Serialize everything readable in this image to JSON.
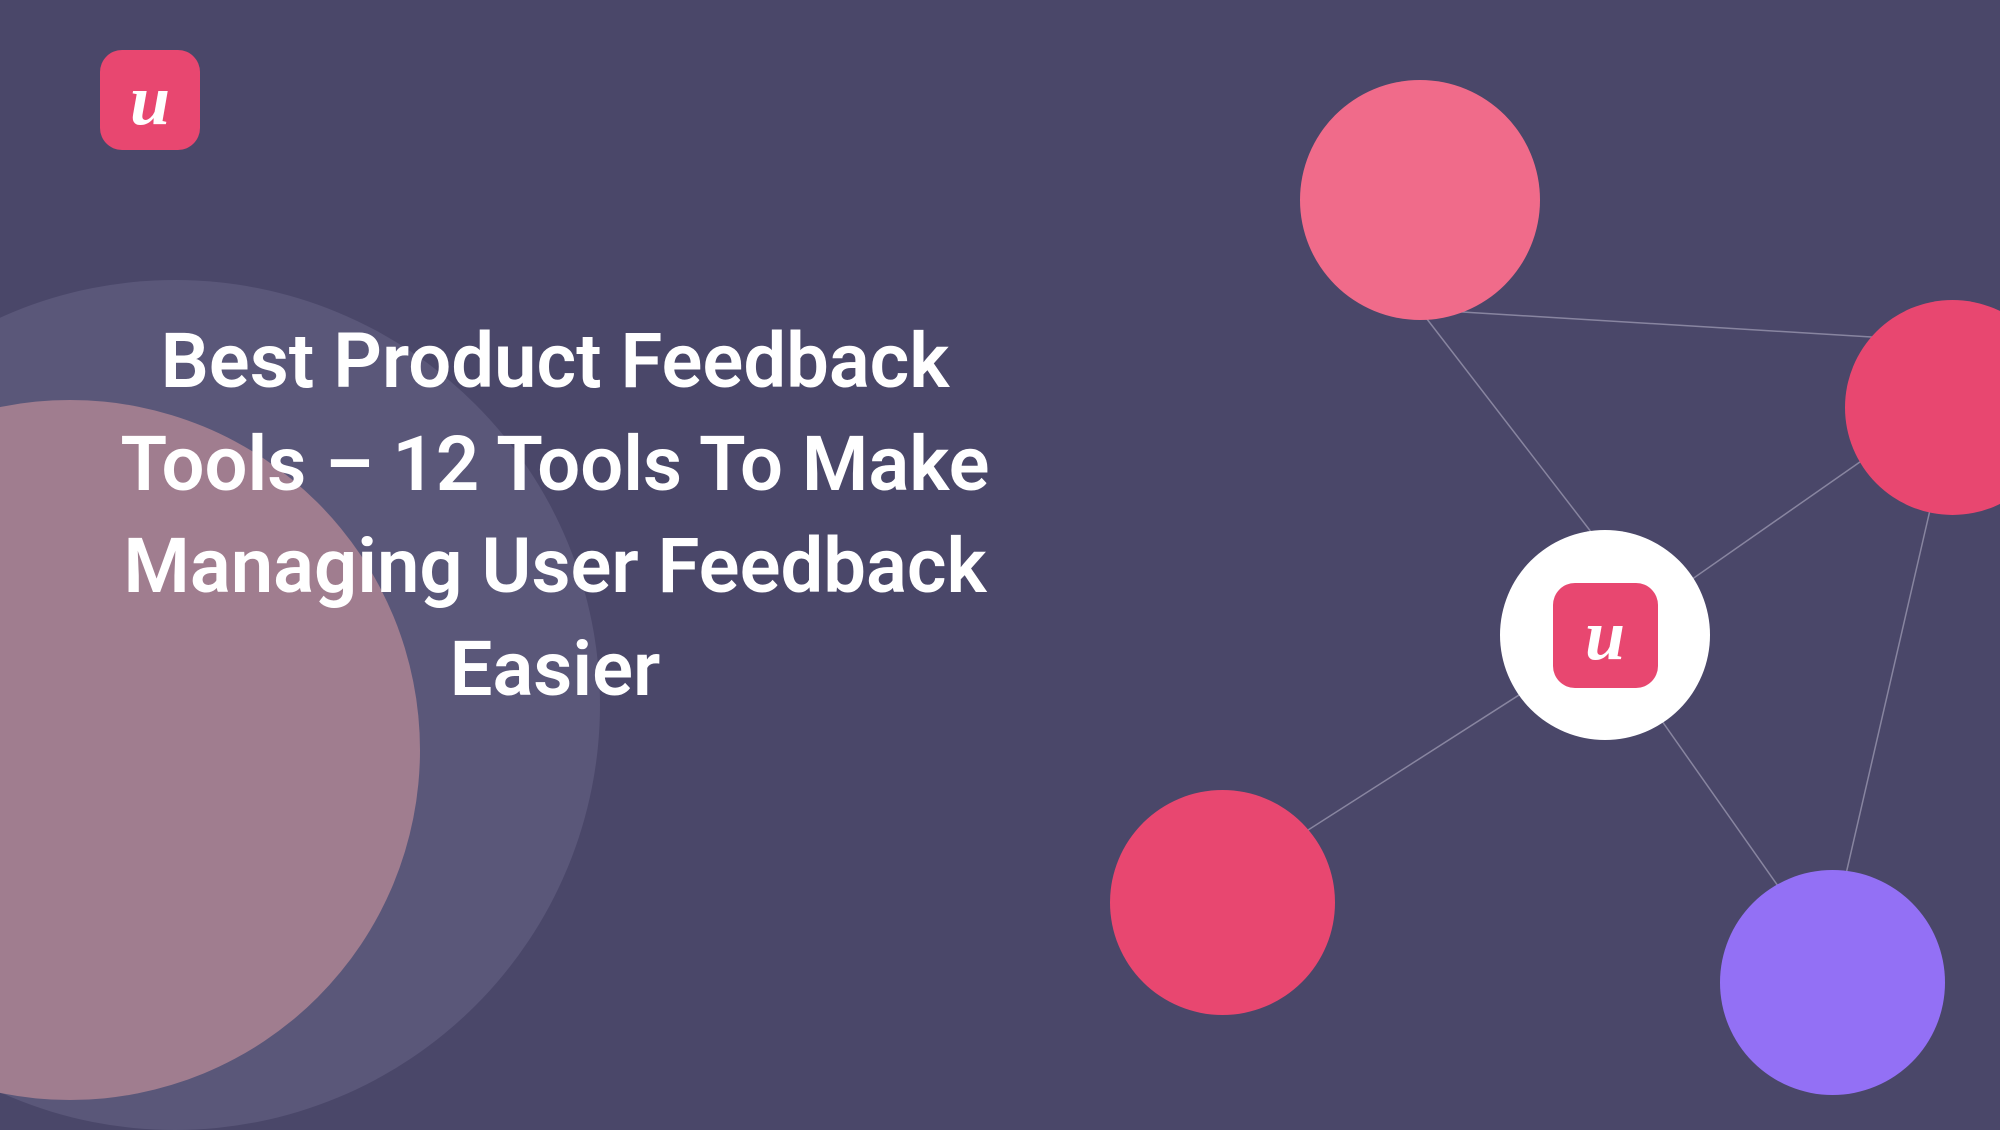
{
  "title": "Best Product Feedback Tools –  12 Tools To Make Managing User Feedback Easier",
  "logo": {
    "letter": "u"
  },
  "colors": {
    "background": "#4a4769",
    "pink": "#e84770",
    "lightPink": "#f06b8a",
    "purple": "#9370f5",
    "mauve": "#a07d8f"
  }
}
